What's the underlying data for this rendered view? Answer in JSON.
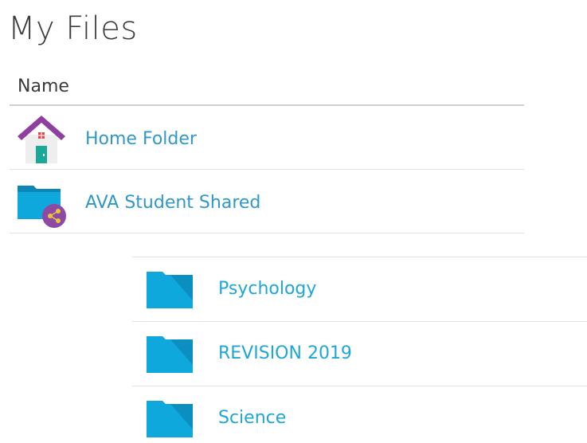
{
  "header": {
    "title": "My Files"
  },
  "columns": {
    "name_label": "Name"
  },
  "items": [
    {
      "label": "Home Folder",
      "icon": "home-folder-icon"
    },
    {
      "label": "AVA Student Shared",
      "icon": "shared-folder-icon"
    }
  ],
  "subfolders": [
    {
      "label": "Psychology",
      "icon": "folder-icon"
    },
    {
      "label": "REVISION 2019",
      "icon": "folder-icon"
    },
    {
      "label": "Science",
      "icon": "folder-icon"
    }
  ],
  "colors": {
    "link": "#2f98c9",
    "subfolder_link": "#1ea7d5",
    "folder": "#0fa8dc",
    "roof": "#8e3fa0",
    "door": "#1aa899",
    "share_badge": "#8d49a4"
  }
}
